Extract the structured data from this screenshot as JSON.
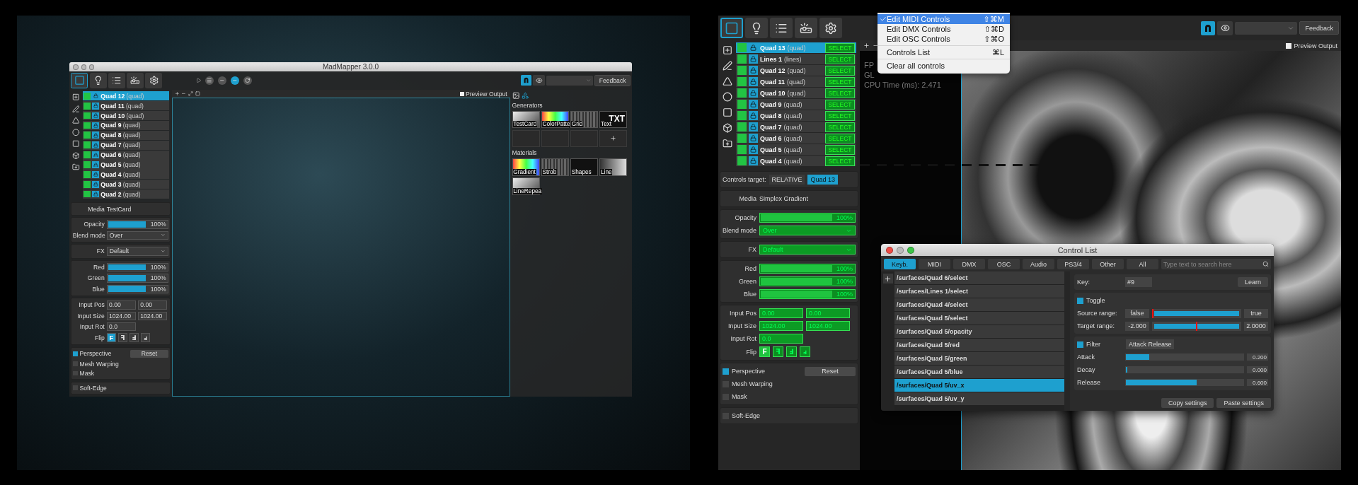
{
  "left_screenshot": {
    "window": {
      "title": "MadMapper 3.0.0"
    },
    "toolbar": {
      "feedback": "Feedback"
    },
    "preview_output": {
      "label": "Preview Output",
      "checked": false
    },
    "panel": {
      "surfaces": [
        {
          "name": "Quad 12",
          "type": "(quad)",
          "selected": true
        },
        {
          "name": "Quad 11",
          "type": "(quad)",
          "selected": false
        },
        {
          "name": "Quad 10",
          "type": "(quad)",
          "selected": false
        },
        {
          "name": "Quad 9",
          "type": "(quad)",
          "selected": false
        },
        {
          "name": "Quad 8",
          "type": "(quad)",
          "selected": false
        },
        {
          "name": "Quad 7",
          "type": "(quad)",
          "selected": false
        },
        {
          "name": "Quad 6",
          "type": "(quad)",
          "selected": false
        },
        {
          "name": "Quad 5",
          "type": "(quad)",
          "selected": false
        },
        {
          "name": "Quad 4",
          "type": "(quad)",
          "selected": false
        },
        {
          "name": "Quad 3",
          "type": "(quad)",
          "selected": false
        },
        {
          "name": "Quad 2",
          "type": "(quad)",
          "selected": false
        }
      ],
      "media": {
        "label": "Media",
        "value": "TestCard"
      },
      "opacity": {
        "label": "Opacity",
        "level": 1,
        "reading": "100%"
      },
      "blend_mode": {
        "label": "Blend mode",
        "value": "Over"
      },
      "fx": {
        "label": "FX",
        "value": "Default"
      },
      "colors": [
        {
          "label": "Red",
          "level": 1,
          "reading": "100%"
        },
        {
          "label": "Green",
          "level": 1,
          "reading": "100%"
        },
        {
          "label": "Blue",
          "level": 1,
          "reading": "100%"
        }
      ],
      "inputs": [
        {
          "label": "Input Pos",
          "values": [
            "0.00",
            "0.00"
          ]
        },
        {
          "label": "Input Size",
          "values": [
            "1024.00",
            "1024.00"
          ]
        },
        {
          "label": "Input Rot",
          "values": [
            "0.0"
          ]
        }
      ],
      "flip": {
        "label": "Flip",
        "buttons": [
          {
            "label": "F",
            "selected": true
          },
          {
            "label": "ꟻ",
            "selected": false
          },
          {
            "label": "Ⅎ",
            "selected": false
          },
          {
            "label": "ⅎ",
            "selected": false
          }
        ]
      },
      "options": [
        {
          "label": "Perspective",
          "checked": true
        },
        {
          "label": "Mesh Warping",
          "checked": false
        },
        {
          "label": "Mask",
          "checked": false
        }
      ],
      "reset": "Reset",
      "soft_edge": {
        "label": "Soft-Edge",
        "checked": false
      }
    },
    "generators": {
      "title": "Generators",
      "items": [
        {
          "label": "TestCard"
        },
        {
          "label": "ColorPatte"
        },
        {
          "label": "Grid"
        },
        {
          "label": "Text",
          "thumb_text": "TXT"
        }
      ]
    },
    "materials": {
      "title": "Materials",
      "items": [
        {
          "label": "Gradient"
        },
        {
          "label": "Strob"
        },
        {
          "label": "Shapes"
        },
        {
          "label": "Line"
        },
        {
          "label": "LineRepea"
        }
      ]
    }
  },
  "main_app": {
    "toolbar": {
      "feedback": "Feedback"
    },
    "preview_output": {
      "label": "Preview Output",
      "checked": false
    },
    "stats": [
      "FP",
      "GL",
      "CPU Time (ms): 2.471"
    ],
    "panel": {
      "surfaces": [
        {
          "name": "Quad 13",
          "type": "(quad)",
          "button": "SELECT",
          "selected": true
        },
        {
          "name": "Lines 1",
          "type": "(lines)",
          "button": "SELECT",
          "selected": false
        },
        {
          "name": "Quad 12",
          "type": "(quad)",
          "button": "SELECT",
          "selected": false
        },
        {
          "name": "Quad 11",
          "type": "(quad)",
          "button": "SELECT",
          "selected": false
        },
        {
          "name": "Quad 10",
          "type": "(quad)",
          "button": "SELECT",
          "selected": false
        },
        {
          "name": "Quad 9",
          "type": "(quad)",
          "button": "SELECT",
          "selected": false
        },
        {
          "name": "Quad 8",
          "type": "(quad)",
          "button": "SELECT",
          "selected": false
        },
        {
          "name": "Quad 7",
          "type": "(quad)",
          "button": "SELECT",
          "selected": false
        },
        {
          "name": "Quad 6",
          "type": "(quad)",
          "button": "SELECT",
          "selected": false
        },
        {
          "name": "Quad 5",
          "type": "(quad)",
          "button": "SELECT",
          "selected": false
        },
        {
          "name": "Quad 4",
          "type": "(quad)",
          "button": "SELECT",
          "selected": false
        }
      ],
      "controls_target": {
        "label": "Controls target:",
        "mode": "RELATIVE",
        "target": "Quad 13"
      },
      "media": {
        "label": "Media",
        "value": "Simplex Gradient"
      },
      "opacity": {
        "label": "Opacity",
        "level": 1,
        "reading": "100%"
      },
      "blend_mode": {
        "label": "Blend mode",
        "value": "Over"
      },
      "fx": {
        "label": "FX",
        "value": "Default"
      },
      "colors": [
        {
          "label": "Red",
          "level": 1,
          "reading": "100%"
        },
        {
          "label": "Green",
          "level": 1,
          "reading": "100%"
        },
        {
          "label": "Blue",
          "level": 1,
          "reading": "100%"
        }
      ],
      "inputs": [
        {
          "label": "Input Pos",
          "values": [
            "0.00",
            "0.00"
          ]
        },
        {
          "label": "Input Size",
          "values": [
            "1024.00",
            "1024.00"
          ]
        },
        {
          "label": "Input Rot",
          "values": [
            "0.0"
          ]
        }
      ],
      "flip": {
        "label": "Flip",
        "buttons": [
          {
            "label": "F",
            "selected": true
          },
          {
            "label": "ꟻ",
            "selected": false
          },
          {
            "label": "Ⅎ",
            "selected": false
          },
          {
            "label": "ⅎ",
            "selected": false
          }
        ]
      },
      "options": [
        {
          "label": "Perspective",
          "checked": true
        },
        {
          "label": "Mesh Warping",
          "checked": false
        },
        {
          "label": "Mask",
          "checked": false
        }
      ],
      "reset": "Reset",
      "soft_edge": {
        "label": "Soft-Edge",
        "checked": false
      }
    },
    "menu": {
      "groups": [
        [
          {
            "label": "Edit MIDI Controls",
            "shortcut": "⇧⌘M",
            "checked": true,
            "selected": true
          },
          {
            "label": "Edit DMX Controls",
            "shortcut": "⇧⌘D",
            "checked": false,
            "selected": false
          },
          {
            "label": "Edit OSC Controls",
            "shortcut": "⇧⌘O",
            "checked": false,
            "selected": false
          }
        ],
        [
          {
            "label": "Controls List",
            "shortcut": "⌘L",
            "checked": false,
            "selected": false
          }
        ],
        [
          {
            "label": "Clear all controls",
            "checked": false,
            "selected": false
          }
        ]
      ]
    },
    "control_list": {
      "title": "Control List",
      "tabs": [
        {
          "label": "Keyb.",
          "selected": true
        },
        {
          "label": "MIDI",
          "selected": false
        },
        {
          "label": "DMX",
          "selected": false
        },
        {
          "label": "OSC",
          "selected": false
        },
        {
          "label": "Audio",
          "selected": false
        },
        {
          "label": "PS3/4",
          "selected": false
        },
        {
          "label": "Other",
          "selected": false
        },
        {
          "label": "All",
          "selected": false
        }
      ],
      "search": {
        "placeholder": "Type text to search here"
      },
      "items": [
        {
          "label": "/surfaces/Quad 6/select",
          "selected": false
        },
        {
          "label": "/surfaces/Lines 1/select",
          "selected": false
        },
        {
          "label": "/surfaces/Quad 4/select",
          "selected": false
        },
        {
          "label": "/surfaces/Quad 5/select",
          "selected": false
        },
        {
          "label": "/surfaces/Quad 5/opacity",
          "selected": false
        },
        {
          "label": "/surfaces/Quad 5/red",
          "selected": false
        },
        {
          "label": "/surfaces/Quad 5/green",
          "selected": false
        },
        {
          "label": "/surfaces/Quad 5/blue",
          "selected": false
        },
        {
          "label": "/surfaces/Quad 5/uv_x",
          "selected": true
        },
        {
          "label": "/surfaces/Quad 5/uv_y",
          "selected": false
        }
      ],
      "key": {
        "label": "Key:",
        "value": "#9"
      },
      "learn": "Learn",
      "toggle": {
        "label": "Toggle",
        "checked": true
      },
      "ranges": [
        {
          "label": "Source range:",
          "min": "false",
          "max": "true",
          "level": 1,
          "marker": {
            "level": 0
          }
        },
        {
          "label": "Target range:",
          "min": "-2.000",
          "max": "2.0000",
          "level": 1,
          "marker": {
            "level": 0.5
          }
        }
      ],
      "filter": {
        "label": "Filter",
        "checked": true,
        "mode": "Attack Release"
      },
      "filter_params": [
        {
          "label": "Attack",
          "level": 0.2,
          "reading": "0.200"
        },
        {
          "label": "Decay",
          "level": 0,
          "reading": "0.000"
        },
        {
          "label": "Release",
          "level": 0.6,
          "reading": "0.600"
        }
      ],
      "buttons": [
        "Copy settings",
        "Paste settings"
      ]
    }
  }
}
